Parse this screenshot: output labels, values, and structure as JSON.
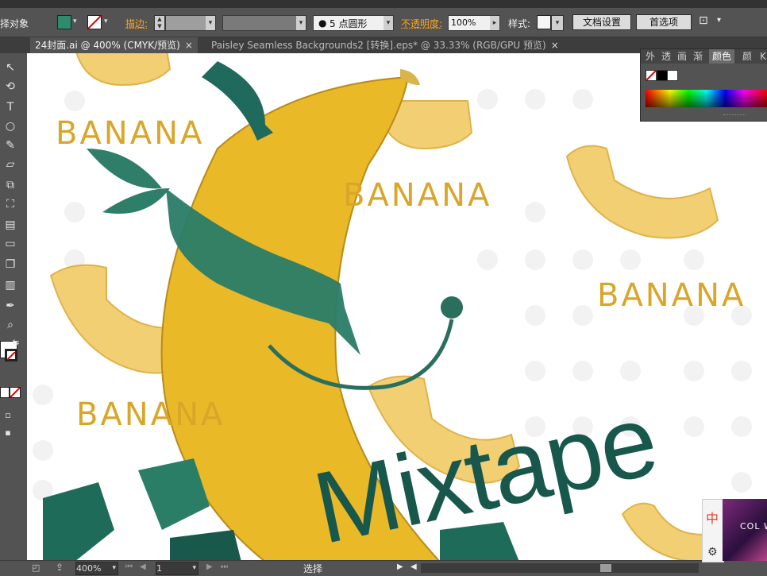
{
  "control_bar": {
    "selection_label": "择对象",
    "stroke_label": "描边:",
    "brush_label": "5 点圆形",
    "opacity_label": "不透明度:",
    "opacity_value": "100%",
    "style_label": "样式:",
    "doc_setup_btn": "文档设置",
    "prefs_btn": "首选项"
  },
  "tabs": [
    {
      "label": "24封面.ai @ 400% (CMYK/预览)",
      "close": "×"
    },
    {
      "label": "Paisley Seamless Backgrounds2 [转换].eps* @ 33.33% (RGB/GPU 预览)",
      "close": "×"
    }
  ],
  "panel": {
    "tabs": [
      "外",
      "透",
      "画",
      "渐",
      "颜色",
      "颜",
      "K"
    ],
    "active_tab": "颜色"
  },
  "canvas": {
    "banana_words": [
      "BANANA",
      "BANANA",
      "BANANA",
      "BANANA"
    ],
    "mixtape": "Mixtape"
  },
  "status": {
    "zoom": "400%",
    "page": "1",
    "tool_label": "选择"
  },
  "widget": {
    "ime_char": "中",
    "promo_text": "COL W"
  },
  "colors": {
    "fill": "#2e8b6e",
    "banana_outline": "#d9a62a",
    "banana_fill": "#f2c75c",
    "teal_dark": "#17574c"
  }
}
